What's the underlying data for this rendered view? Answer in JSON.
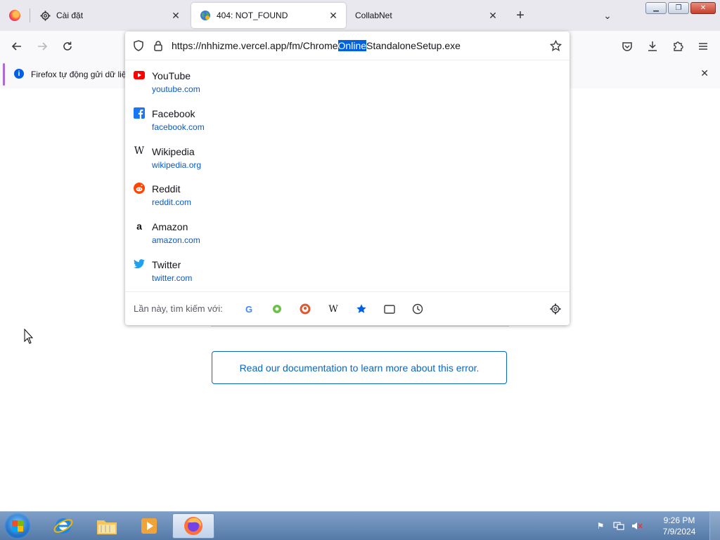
{
  "window": {
    "tabs": [
      {
        "title": "Cài đặt",
        "icon": "gear-icon",
        "active": false
      },
      {
        "title": "404: NOT_FOUND",
        "icon": "globe-icon",
        "active": true
      },
      {
        "title": "CollabNet",
        "icon": "",
        "active": false
      }
    ]
  },
  "urlbar": {
    "url_prefix": "https://nhhizme.vercel.app/fm/Chrome",
    "url_selected": "Online",
    "url_suffix": "StandaloneSetup.exe"
  },
  "results": [
    {
      "title": "YouTube",
      "url": "youtube.com",
      "icon": "youtube-icon",
      "color": "#ff0000"
    },
    {
      "title": "Facebook",
      "url": "facebook.com",
      "icon": "facebook-icon",
      "color": "#1877f2"
    },
    {
      "title": "Wikipedia",
      "url": "wikipedia.org",
      "icon": "wikipedia-icon",
      "color": "#000000"
    },
    {
      "title": "Reddit",
      "url": "reddit.com",
      "icon": "reddit-icon",
      "color": "#ff4500"
    },
    {
      "title": "Amazon",
      "url": "amazon.com",
      "icon": "amazon-icon",
      "color": "#000000"
    },
    {
      "title": "Twitter",
      "url": "twitter.com",
      "icon": "twitter-icon",
      "color": "#1da1f2"
    }
  ],
  "search_strip": {
    "label": "Lần này, tìm kiếm với:",
    "engines": [
      "google-icon",
      "coc-coc-icon",
      "duckduckgo-icon",
      "wikipedia-icon",
      "bookmarks-icon",
      "tabs-icon",
      "history-icon"
    ]
  },
  "notification": {
    "text": "Firefox tự động gửi dữ liệ"
  },
  "page": {
    "doc_link": "Read our documentation to learn more about this error."
  },
  "taskbar": {
    "time": "9:26 PM",
    "date": "7/9/2024"
  },
  "colors": {
    "accent": "#0061e0",
    "link": "#0a66c2"
  }
}
